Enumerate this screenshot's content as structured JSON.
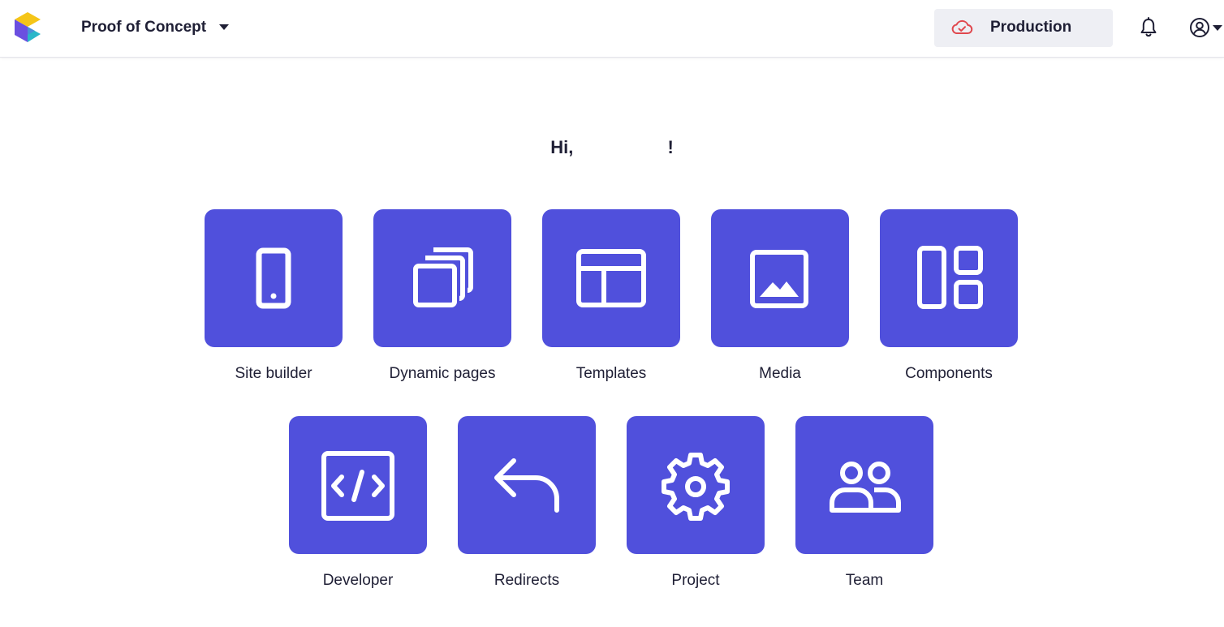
{
  "header": {
    "project_name": "Proof of Concept",
    "environment_label": "Production",
    "icons": {
      "logo": "app-logo",
      "project_caret": "caret-down-icon",
      "environment": "cloud-check-icon",
      "environment_caret": "caret-down-icon",
      "notifications": "bell-icon",
      "account": "user-circle-icon"
    }
  },
  "greeting": {
    "text": "Hi,                   !"
  },
  "tiles": [
    {
      "label": "Site builder",
      "icon": "mobile-device-icon"
    },
    {
      "label": "Dynamic pages",
      "icon": "stacked-pages-icon"
    },
    {
      "label": "Templates",
      "icon": "layout-template-icon"
    },
    {
      "label": "Media",
      "icon": "image-icon"
    },
    {
      "label": "Components",
      "icon": "components-grid-icon"
    },
    {
      "label": "Developer",
      "icon": "code-icon"
    },
    {
      "label": "Redirects",
      "icon": "reply-arrow-icon"
    },
    {
      "label": "Project",
      "icon": "gear-icon"
    },
    {
      "label": "Team",
      "icon": "team-icon"
    }
  ],
  "colors": {
    "tile_background": "#5050dc",
    "text": "#1f1f35",
    "environment_background": "#eeeff4",
    "environment_icon": "#e0484e",
    "logo_yellow": "#f5c518",
    "logo_purple": "#6b4fe0",
    "logo_teal": "#2ab7c9"
  }
}
